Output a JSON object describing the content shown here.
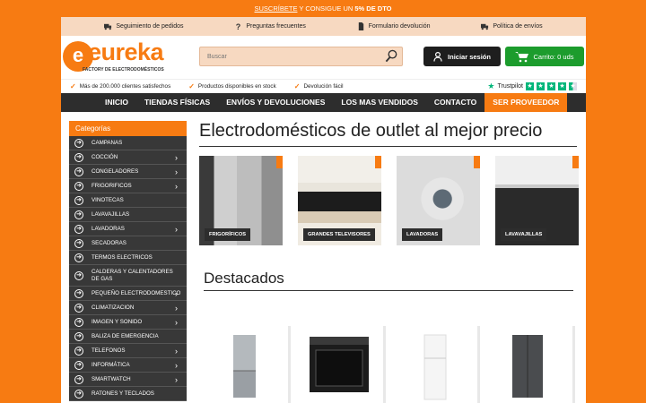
{
  "promo": {
    "link": "SUSCRÍBETE",
    "text": " Y CONSIGUE UN ",
    "bold": "5% DE DTO"
  },
  "infobar": [
    {
      "icon": "truck-icon",
      "label": "Seguimiento de pedidos"
    },
    {
      "icon": "question-icon",
      "label": "Preguntas frecuentes"
    },
    {
      "icon": "document-icon",
      "label": "Formulario devolución"
    },
    {
      "icon": "shipping-icon",
      "label": "Política de envíos"
    }
  ],
  "logo": {
    "mark": "e",
    "name": "eureka",
    "tagline": "FACTORY DE ELECTRODOMÉSTICOS"
  },
  "search": {
    "placeholder": "Buscar"
  },
  "login": {
    "label": "Iniciar sesión"
  },
  "cart": {
    "label": "Carrito: 0 uds"
  },
  "trust": {
    "items": [
      "Más de 200.000 clientes satisfechos",
      "Productos disponibles en stock",
      "Devolución fácil"
    ],
    "brand": "Trustpilot",
    "rating": 4.5
  },
  "nav": [
    "INICIO",
    "TIENDAS FÍSICAS",
    "ENVÍOS Y DEVOLUCIONES",
    "LOS MAS VENDIDOS",
    "CONTACTO",
    "SER PROVEEDOR"
  ],
  "sidebar": {
    "title": "Categorías",
    "items": [
      {
        "label": "CAMPANAS",
        "sub": false
      },
      {
        "label": "COCCIÓN",
        "sub": true
      },
      {
        "label": "CONGELADORES",
        "sub": true
      },
      {
        "label": "FRIGORIFICOS",
        "sub": true
      },
      {
        "label": "VINOTECAS",
        "sub": false
      },
      {
        "label": "LAVAVAJILLAS",
        "sub": false
      },
      {
        "label": "LAVADORAS",
        "sub": true
      },
      {
        "label": "SECADORAS",
        "sub": false
      },
      {
        "label": "TERMOS ELECTRICOS",
        "sub": false
      },
      {
        "label": "CALDERAS Y CALENTADORES DE GAS",
        "sub": false,
        "tall": true
      },
      {
        "label": "PEQUEÑO ELECTRODOMESTICO",
        "sub": true
      },
      {
        "label": "CLIMATIZACION",
        "sub": true
      },
      {
        "label": "IMAGEN Y SONIDO",
        "sub": true
      },
      {
        "label": "BALIZA DE EMERGENCIA",
        "sub": false
      },
      {
        "label": "TELEFONOS",
        "sub": true
      },
      {
        "label": "INFORMÁTICA",
        "sub": true
      },
      {
        "label": "SMARTWATCH",
        "sub": true
      },
      {
        "label": "RATONES Y TECLADOS",
        "sub": false
      }
    ]
  },
  "main": {
    "title": "Electrodomésticos de outlet al mejor precio",
    "tiles": [
      "FRIGORÍFICOS",
      "GRANDES TELEVISORES",
      "LAVADORAS",
      "LAVAVAJILLAS"
    ],
    "featured_title": "Destacados",
    "prev": "‹",
    "next": "›"
  },
  "colors": {
    "accent": "#f77b12",
    "dark": "#2d2d2d",
    "cart": "#1c9c2d",
    "trustpilot": "#00b67a"
  }
}
